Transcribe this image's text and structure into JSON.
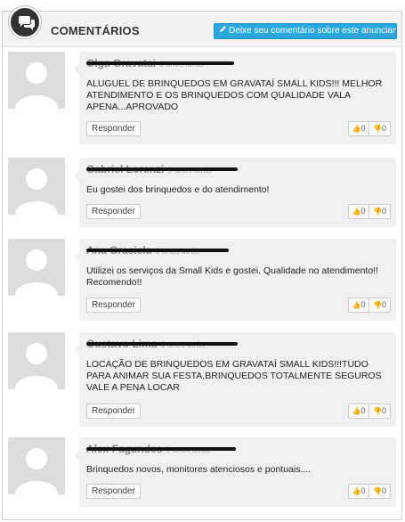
{
  "header": {
    "title": "COMENTÁRIOS",
    "add_button_label": "Deixe seu comentário sobre este anunciante",
    "chat_icon": "chat-bubbles-icon",
    "pen_icon": "pencil-icon"
  },
  "reply_label": "Responder",
  "comments": [
    {
      "author": "Olga Gravatai",
      "ago": "3 anos atrás",
      "text": "ALUGUEL DE BRINQUEDOS EM GRAVATAÍ SMALL KIDS!!! MELHOR ATENDIMENTO E OS BRINQUEDOS COM QUALIDADE VALA APENA...APROVADO",
      "likes": "0",
      "dislikes": "0"
    },
    {
      "author": "Gabriel Lorenzi",
      "ago": "3 anos atrás",
      "text": "Eu gostei dos brinquedos e do atendimento!",
      "likes": "0",
      "dislikes": "0"
    },
    {
      "author": "Ana Graciela",
      "ago": "3 anos atrás",
      "text": "Utilizei os serviços da Small Kids e gostei. Qualidade no atendimento!! Recomendo!!",
      "likes": "0",
      "dislikes": "0"
    },
    {
      "author": "Gustavo Lima",
      "ago": "3 anos atrás",
      "text": "LOCAÇÃO DE BRINQUEDOS EM GRAVATAÍ SMALL KIDS!!!TUDO PARA ANIMAR SUA FESTA,BRINQUEDOS TOTALMENTE SEGUROS VALE A PENA LOCAR",
      "likes": "0",
      "dislikes": "0"
    },
    {
      "author": "Alex Fagundes",
      "ago": "3 anos atrás",
      "text": "Brinquedos novos, monitores atenciosos e pontuais....",
      "likes": "0",
      "dislikes": "0"
    }
  ],
  "colors": {
    "accent": "#2aa7dc",
    "card_bg": "#f0f0f0",
    "avatar_bg": "#dcdcdc"
  }
}
